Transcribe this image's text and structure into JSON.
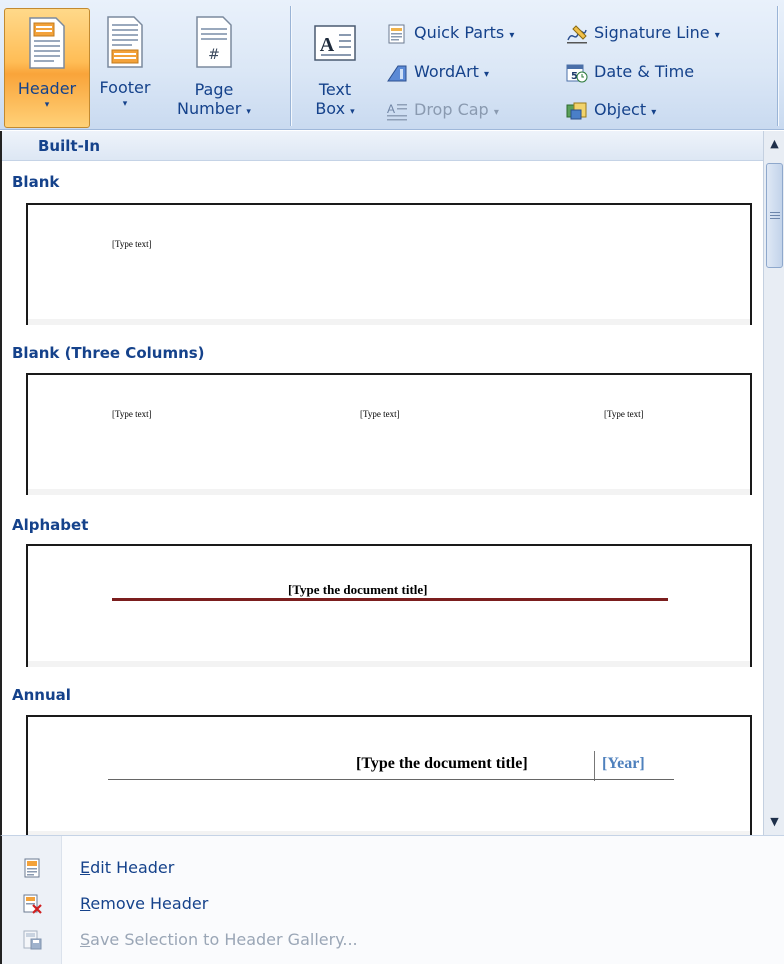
{
  "ribbon": {
    "header_label": "Header",
    "footer_label": "Footer",
    "page_number_label_1": "Page",
    "page_number_label_2": "Number",
    "text_box_label_1": "Text",
    "text_box_label_2": "Box",
    "quick_parts": "Quick Parts",
    "wordart": "WordArt",
    "drop_cap": "Drop Cap",
    "signature_line": "Signature Line",
    "date_time": "Date & Time",
    "object": "Object",
    "caret": "▾"
  },
  "gallery": {
    "category": "Built-In",
    "sections": [
      {
        "title": "Blank",
        "texts": [
          "[Type text]"
        ]
      },
      {
        "title": "Blank (Three Columns)",
        "texts": [
          "[Type text]",
          "[Type text]",
          "[Type text]"
        ]
      },
      {
        "title": "Alphabet",
        "doc_title": "[Type the document title]"
      },
      {
        "title": "Annual",
        "doc_title": "[Type the document title]",
        "year": "[Year]"
      }
    ]
  },
  "menu": {
    "edit_header_key": "E",
    "edit_header_rest": "dit Header",
    "remove_header_key": "R",
    "remove_header_rest": "emove Header",
    "save_selection_key": "S",
    "save_selection_rest": "ave Selection to Header Gallery..."
  },
  "colors": {
    "accent_text": "#15428b",
    "active_button": "#ffbd56",
    "alphabet_rule": "#7b1e1e",
    "annual_year": "#4f81bd"
  }
}
